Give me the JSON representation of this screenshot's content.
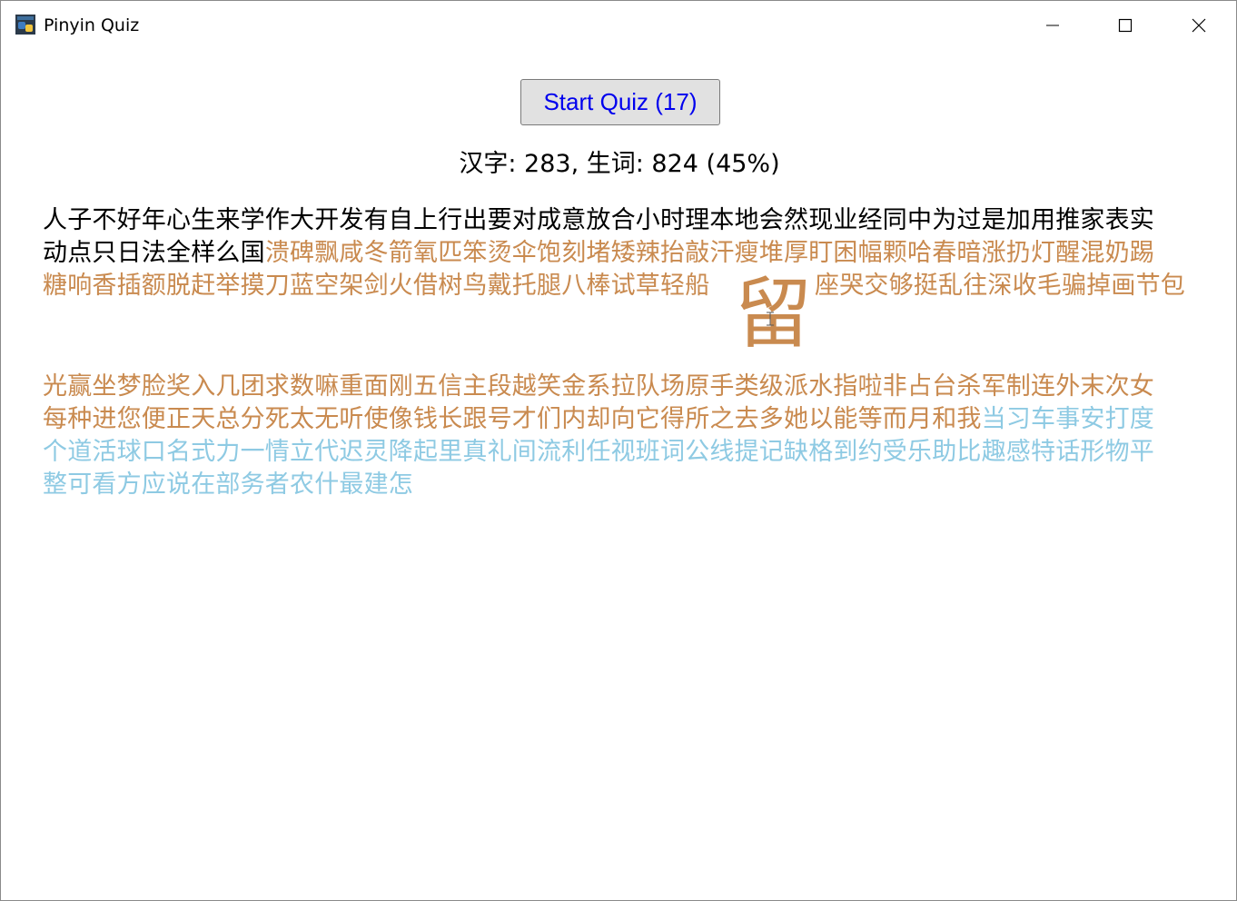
{
  "window": {
    "title": "Pinyin Quiz"
  },
  "toolbar": {
    "start_label": "Start Quiz (17)"
  },
  "stats": {
    "text": "汉字: 283, 生词: 824 (45%)"
  },
  "characters": {
    "line1": "人子不好年心生来学作大开发有自上行出要对成意放合小时理本地会然现业经同中为过是加用推家表实",
    "line2_known": "动点只日法全样么国",
    "line2_learning": "溃碑飘咸冬箭氧匹笨烫伞饱刻堵矮辣抬敲汗瘦堆厚盯困幅颗哈春暗涨扔灯醒混奶踢",
    "line3_left": "糖响香插额脱赶举摸刀蓝空架剑火借树鸟戴托腿八棒试草轻船",
    "line3_highlight": "留",
    "line3_right": "座哭交够挺乱往深收毛骗掉画节包",
    "line4": "光赢坐梦脸奖入几团求数嘛重面刚五信主段越笑金系拉队场原手类级派水指啦非占台杀军制连外末次女",
    "line5_learning": "每种进您便正天总分死太无听使像钱长跟号才们内却向它得所之去多她以能等而月和我",
    "line5_new": "当习车事安打度",
    "line6": "个道活球口名式力一情立代迟灵降起里真礼间流利任视班词公线提记缺格到约受乐助比趣感特话形物平",
    "line7": "整可看方应说在部务者农什最建怎"
  },
  "colors": {
    "known": "#000000",
    "learning": "#c98a4f",
    "new": "#8ecae3",
    "button_text": "#0000ee"
  }
}
